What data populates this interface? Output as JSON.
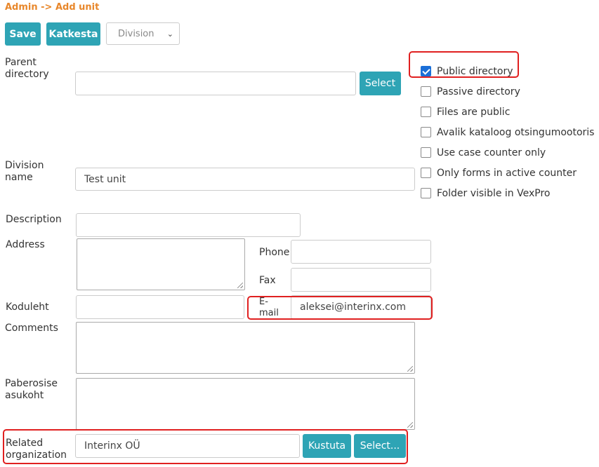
{
  "breadcrumb": "Admin -> Add unit",
  "toolbar": {
    "save_label": "Save",
    "cancel_label": "Katkesta",
    "division_select": "Division"
  },
  "form": {
    "parent_directory": {
      "label": "Parent directory",
      "value": "",
      "button": "Select"
    },
    "division_name": {
      "label": "Division name",
      "value": "Test unit"
    },
    "description": {
      "label": "Description",
      "value": ""
    },
    "address": {
      "label": "Address"
    },
    "phone": {
      "label": "Phone",
      "value": ""
    },
    "fax": {
      "label": "Fax",
      "value": ""
    },
    "koduleht": {
      "label": "Koduleht",
      "value": ""
    },
    "email": {
      "label": "E-mail",
      "value": "aleksei@interinx.com"
    },
    "comments": {
      "label": "Comments"
    },
    "paberosise": {
      "label": "Paberosise asukoht"
    },
    "related_organization": {
      "label": "Related organization",
      "value": "Interinx OÜ",
      "delete_button": "Kustuta",
      "select_button": "Select..."
    }
  },
  "checkboxes": [
    {
      "label": "Public directory",
      "checked": true
    },
    {
      "label": "Passive directory",
      "checked": false
    },
    {
      "label": "Files are public",
      "checked": false
    },
    {
      "label": "Avalik kataloog otsingumootoris",
      "checked": false
    },
    {
      "label": "Use case counter only",
      "checked": false
    },
    {
      "label": "Only forms in active counter",
      "checked": false
    },
    {
      "label": "Folder visible in VexPro",
      "checked": false
    }
  ],
  "colors": {
    "accent": "#2ea4b5",
    "breadcrumb": "#e8872b",
    "highlight": "#e02020",
    "checkbox": "#1b6fd8"
  }
}
